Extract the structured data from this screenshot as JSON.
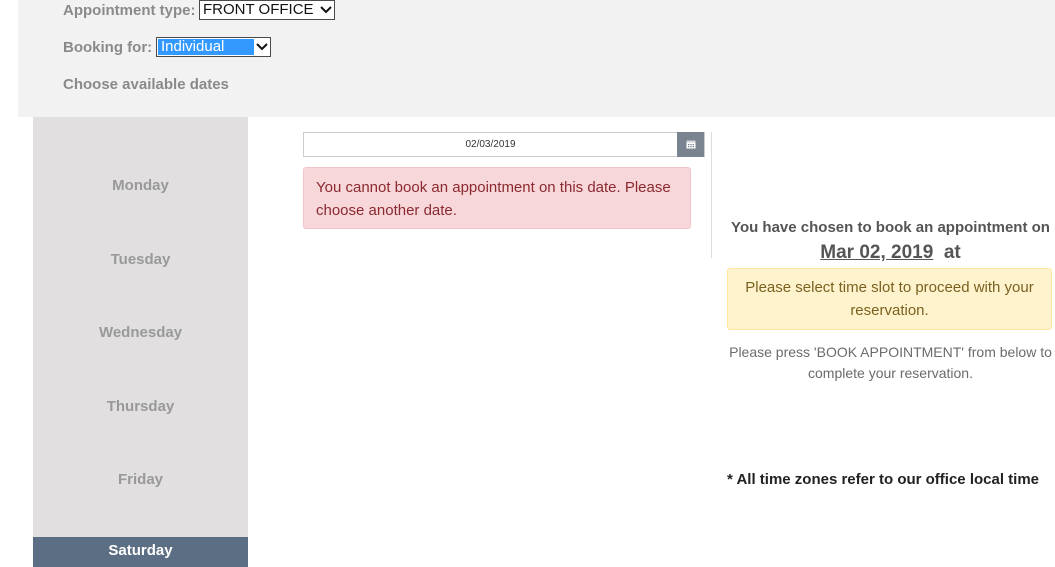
{
  "form": {
    "appointment_type_label": "Appointment type:",
    "appointment_type_value": "FRONT OFFICE",
    "booking_for_label": "Booking for:",
    "booking_for_value": "Individual",
    "choose_dates_label": "Choose available dates"
  },
  "days": [
    "Monday",
    "Tuesday",
    "Wednesday",
    "Thursday",
    "Friday",
    "Saturday"
  ],
  "selected_day": "Saturday",
  "date_input": {
    "value": "02/03/2019",
    "icon": "calendar-icon"
  },
  "error_message": "You cannot book an appointment on this date. Please choose another date.",
  "summary": {
    "chosen_text": "You have chosen to book an appointment on",
    "date": "Mar 02, 2019",
    "at": "at",
    "warning": "Please select time slot to proceed with your reservation.",
    "instruction": "Please press 'BOOK APPOINTMENT' from below to complete your reservation.",
    "timezone_note": "* All time zones refer to our office local time"
  },
  "colors": {
    "selected_day_bg": "#5b6e83",
    "day_column_bg": "#e1dfdf",
    "error_bg": "#f7d7da",
    "warning_bg": "#fff3cd"
  }
}
